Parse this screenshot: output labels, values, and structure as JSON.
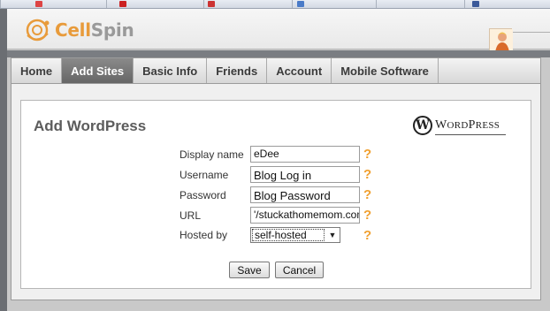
{
  "brand": {
    "name_part1": "Cell",
    "name_part2": "Spin"
  },
  "nav": {
    "items": [
      {
        "label": "Home",
        "active": false
      },
      {
        "label": "Add Sites",
        "active": true
      },
      {
        "label": "Basic Info",
        "active": false
      },
      {
        "label": "Friends",
        "active": false
      },
      {
        "label": "Account",
        "active": false
      },
      {
        "label": "Mobile Software",
        "active": false
      }
    ]
  },
  "panel": {
    "title": "Add WordPress",
    "wordpress_logo": {
      "letter": "W",
      "word_first": "W",
      "word_rest": "ORD",
      "word_second": "P",
      "word_rest2": "RESS"
    }
  },
  "form": {
    "display_name": {
      "label": "Display name",
      "value": "eDee"
    },
    "username": {
      "label": "Username",
      "value": "Blog Log in"
    },
    "password": {
      "label": "Password",
      "value": "Blog Password"
    },
    "url": {
      "label": "URL",
      "value": "'/stuckathomemom.com/"
    },
    "hosted_by": {
      "label": "Hosted by",
      "value": "self-hosted"
    },
    "help_glyph": "?"
  },
  "buttons": {
    "save": "Save",
    "cancel": "Cancel"
  },
  "colors": {
    "brand_orange": "#e89b3b",
    "help_orange": "#f0a030",
    "nav_active": "#777777"
  },
  "icons": {
    "logo": "cellspin-logo-icon",
    "avatar": "user-avatar-icon",
    "wordpress": "wordpress-logo-icon",
    "dropdown": "chevron-down-icon"
  }
}
